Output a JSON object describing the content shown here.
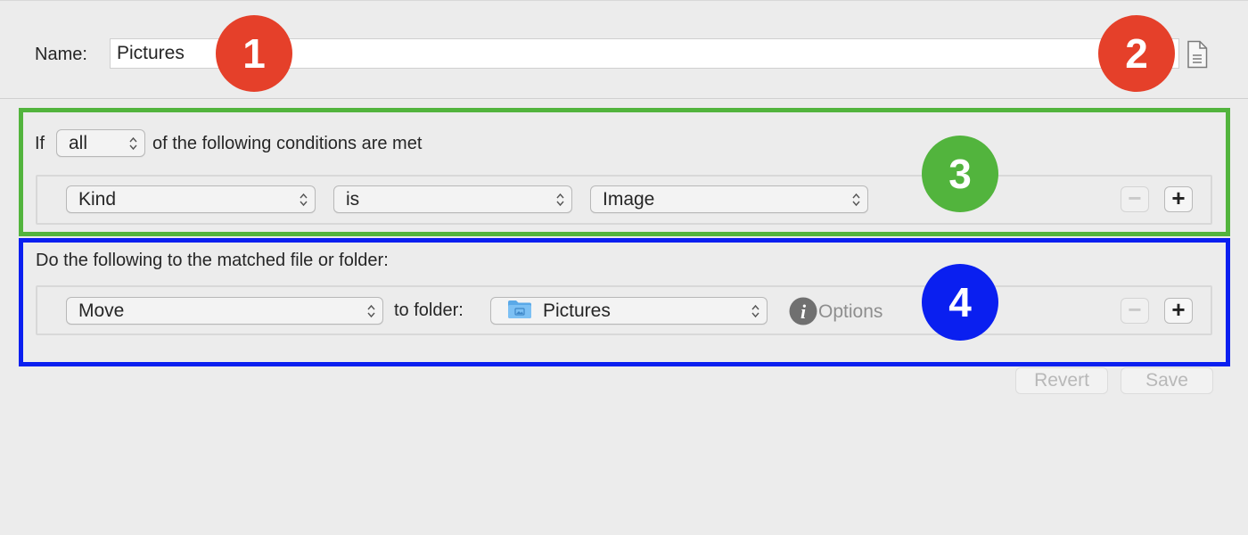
{
  "rule": {
    "name_label": "Name:",
    "name_value": "Pictures"
  },
  "conditions": {
    "prefix": "If",
    "match_mode": "all",
    "suffix": "of the following conditions are met",
    "row": {
      "attribute": "Kind",
      "operator": "is",
      "value": "Image"
    }
  },
  "actions": {
    "heading": "Do the following to the matched file or folder:",
    "row": {
      "action": "Move",
      "to_label": "to folder:",
      "folder": "Pictures",
      "options_label": "Options"
    }
  },
  "footer": {
    "revert_label": "Revert",
    "save_label": "Save"
  },
  "annotations": {
    "badge_1": "1",
    "badge_2": "2",
    "badge_3": "3",
    "badge_4": "4",
    "color_red": "#e5402a",
    "color_green": "#52b43d",
    "color_blue": "#0a1ff0"
  },
  "icons": {
    "document": "document-icon",
    "info": "info-icon",
    "folder": "folder-icon",
    "updown": "chevron-updown-icon"
  }
}
